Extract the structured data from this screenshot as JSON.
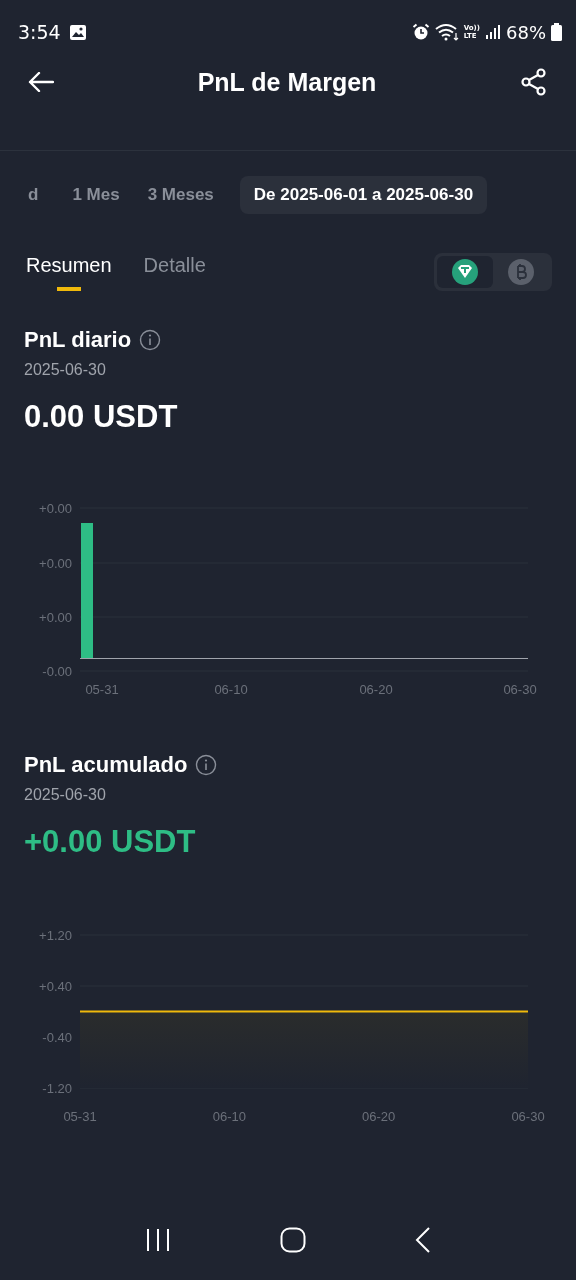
{
  "status_bar": {
    "time": "3:54",
    "volte_top": "Vo))",
    "volte_bottom": "LTE",
    "battery": "68%"
  },
  "header": {
    "title": "PnL de Margen"
  },
  "periods": [
    {
      "label": "d",
      "selected": false
    },
    {
      "label": "1 Mes",
      "selected": false
    },
    {
      "label": "3 Meses",
      "selected": false
    },
    {
      "label": "De 2025-06-01 a 2025-06-30",
      "selected": true
    }
  ],
  "tabs": [
    {
      "label": "Resumen",
      "selected": true
    },
    {
      "label": "Detalle",
      "selected": false
    }
  ],
  "coin_toggle": [
    {
      "kind": "tether",
      "selected": true
    },
    {
      "kind": "bitcoin",
      "selected": false
    }
  ],
  "daily": {
    "title": "PnL diario",
    "date": "2025-06-30",
    "value": "0.00 USDT",
    "positive": false,
    "y_labels": [
      "+0.00",
      "+0.00",
      "+0.00",
      "-0.00"
    ],
    "x_labels": [
      "05-31",
      "06-10",
      "06-20",
      "06-30"
    ]
  },
  "cumulative": {
    "title": "PnL acumulado",
    "date": "2025-06-30",
    "value": "+0.00 USDT",
    "positive": true,
    "chart_data": {
      "type": "line",
      "categories": [
        "05-31",
        "06-10",
        "06-20",
        "06-30"
      ],
      "series": [
        {
          "color": "#f0b90b",
          "values": [
            0,
            0,
            0,
            0
          ]
        }
      ],
      "ylim": [
        -1.2,
        1.2
      ],
      "yticks": [
        {
          "value": 1.2,
          "label": "+1.20"
        },
        {
          "value": 0.4,
          "label": "+0.40"
        },
        {
          "value": -0.4,
          "label": "-0.40"
        },
        {
          "value": -1.2,
          "label": "-1.20"
        }
      ]
    }
  }
}
